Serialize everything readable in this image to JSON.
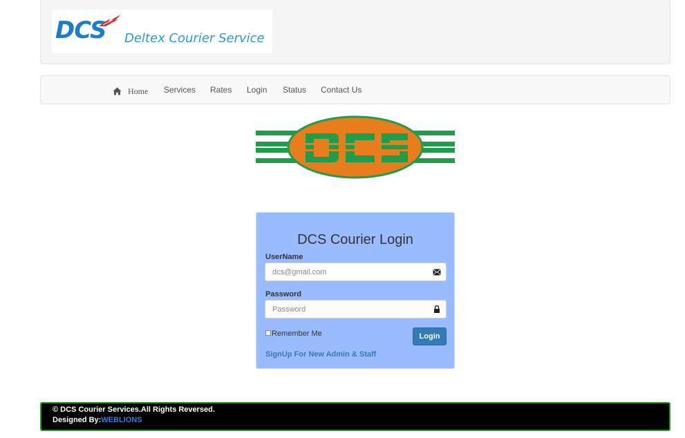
{
  "header": {
    "logo_abbr": "DCS",
    "logo_name": "Deltex Courier Service"
  },
  "nav": {
    "items": [
      {
        "label": "Home",
        "icon": "home-icon"
      },
      {
        "label": "Services"
      },
      {
        "label": "Rates"
      },
      {
        "label": "Login"
      },
      {
        "label": "Status"
      },
      {
        "label": "Contact Us"
      }
    ]
  },
  "big_logo": {
    "text": "DCS",
    "colors": {
      "oval": "#e87d1e",
      "stripes": "#1f9d4a"
    }
  },
  "login": {
    "title": "DCS Courier Login",
    "username_label": "UserName",
    "username_placeholder": "dcs@gmail.com",
    "username_icon": "envelope-icon",
    "password_label": "Password",
    "password_placeholder": "Password",
    "password_icon": "lock-icon",
    "remember_label": "Remember Me",
    "remember_checked": false,
    "button_label": "Login",
    "signup_link": "SignUp For New Admin & Staff",
    "panel_color": "#99bbff"
  },
  "footer": {
    "copyright": "© DCS Courier Services.All Rights Reversed.",
    "designed_by_label": "Designed By:",
    "designer": "WEBLIONS"
  }
}
